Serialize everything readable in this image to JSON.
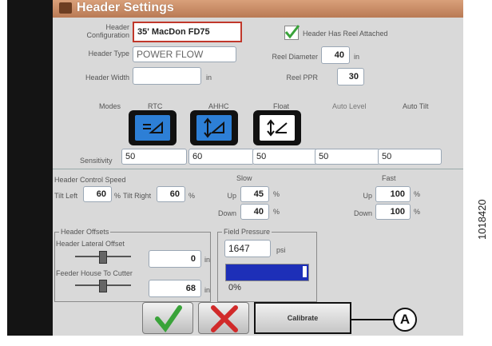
{
  "header": {
    "title": "Header Settings"
  },
  "config": {
    "header_configuration_label": "Header\nConfiguration",
    "header_configuration_value": "35' MacDon FD75",
    "header_type_label": "Header Type",
    "header_type_value": "POWER FLOW",
    "header_width_label": "Header Width",
    "header_width_value": "",
    "header_width_unit": "in",
    "reel_attached_label": "Header Has Reel Attached",
    "reel_attached_checked": true,
    "reel_diameter_label": "Reel Diameter",
    "reel_diameter_value": "40",
    "reel_diameter_unit": "in",
    "reel_ppr_label": "Reel PPR",
    "reel_ppr_value": "30"
  },
  "modes": {
    "label": "Modes",
    "items": [
      {
        "label": "RTC",
        "icon": "rtc-mode-icon"
      },
      {
        "label": "AHHC",
        "icon": "ahhc-mode-icon"
      },
      {
        "label": "Float",
        "icon": "float-mode-icon"
      },
      {
        "label": "Auto Level",
        "icon": ""
      },
      {
        "label": "Auto Tilt",
        "icon": ""
      }
    ]
  },
  "sensitivity": {
    "label": "Sensitivity",
    "values": [
      "50",
      "60",
      "50",
      "50",
      "50"
    ]
  },
  "control_speed": {
    "label": "Header Control Speed",
    "tilt_left_label": "Tilt Left",
    "tilt_left_value": "60",
    "tilt_right_label": "Tilt Right",
    "tilt_right_value": "60",
    "percent": "%",
    "slow_label": "Slow",
    "fast_label": "Fast",
    "up_label": "Up",
    "down_label": "Down",
    "slow_up": "45",
    "slow_down": "40",
    "fast_up": "100",
    "fast_down": "100"
  },
  "offsets": {
    "title": "Header Offsets",
    "lateral_label": "Header Lateral Offset",
    "lateral_value": "0",
    "feeder_label": "Feeder House To Cutter",
    "feeder_value": "68",
    "unit": "in"
  },
  "field_pressure": {
    "title": "Field Pressure",
    "value": "1647",
    "unit": "psi",
    "bar_text": "0%",
    "bar_fraction": 0.95
  },
  "actions": {
    "calibrate_label": "Calibrate"
  },
  "annotations": {
    "callout_label": "A",
    "reference_number": "1018420"
  },
  "colors": {
    "title_bar": "#c98b63",
    "accent_blue": "#2d7fd6",
    "highlight_red": "#c0382b",
    "check_green": "#3aa33a"
  }
}
